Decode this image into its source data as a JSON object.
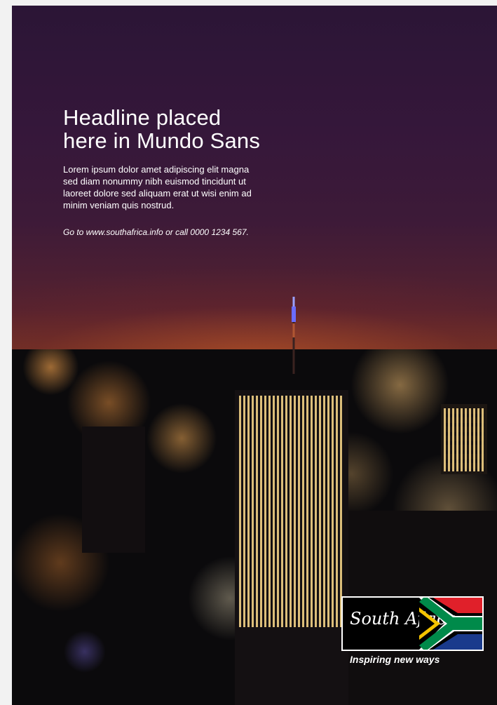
{
  "ad": {
    "headline_line1": "Headline placed",
    "headline_line2": "here in Mundo Sans",
    "body_copy_lines": [
      "Lorem ipsum dolor amet adipiscing elit magna",
      "sed diam nonummy nibh euismod tincidunt ut",
      "laoreet dolore sed aliquam erat ut wisi enim ad",
      "minim veniam quis nostrud."
    ],
    "contact": "Go to www.southafrica.info or call 0000 1234 567."
  },
  "brand": {
    "logo_text": "South Africa",
    "tagline": "Inspiring new ways",
    "flag_colors": {
      "red": "#e0202a",
      "blue": "#1a3a8c",
      "green": "#008a4a",
      "yellow": "#f5c400",
      "black": "#000000",
      "white": "#ffffff"
    }
  },
  "photo": {
    "subject": "night-city-skyline-icon"
  }
}
